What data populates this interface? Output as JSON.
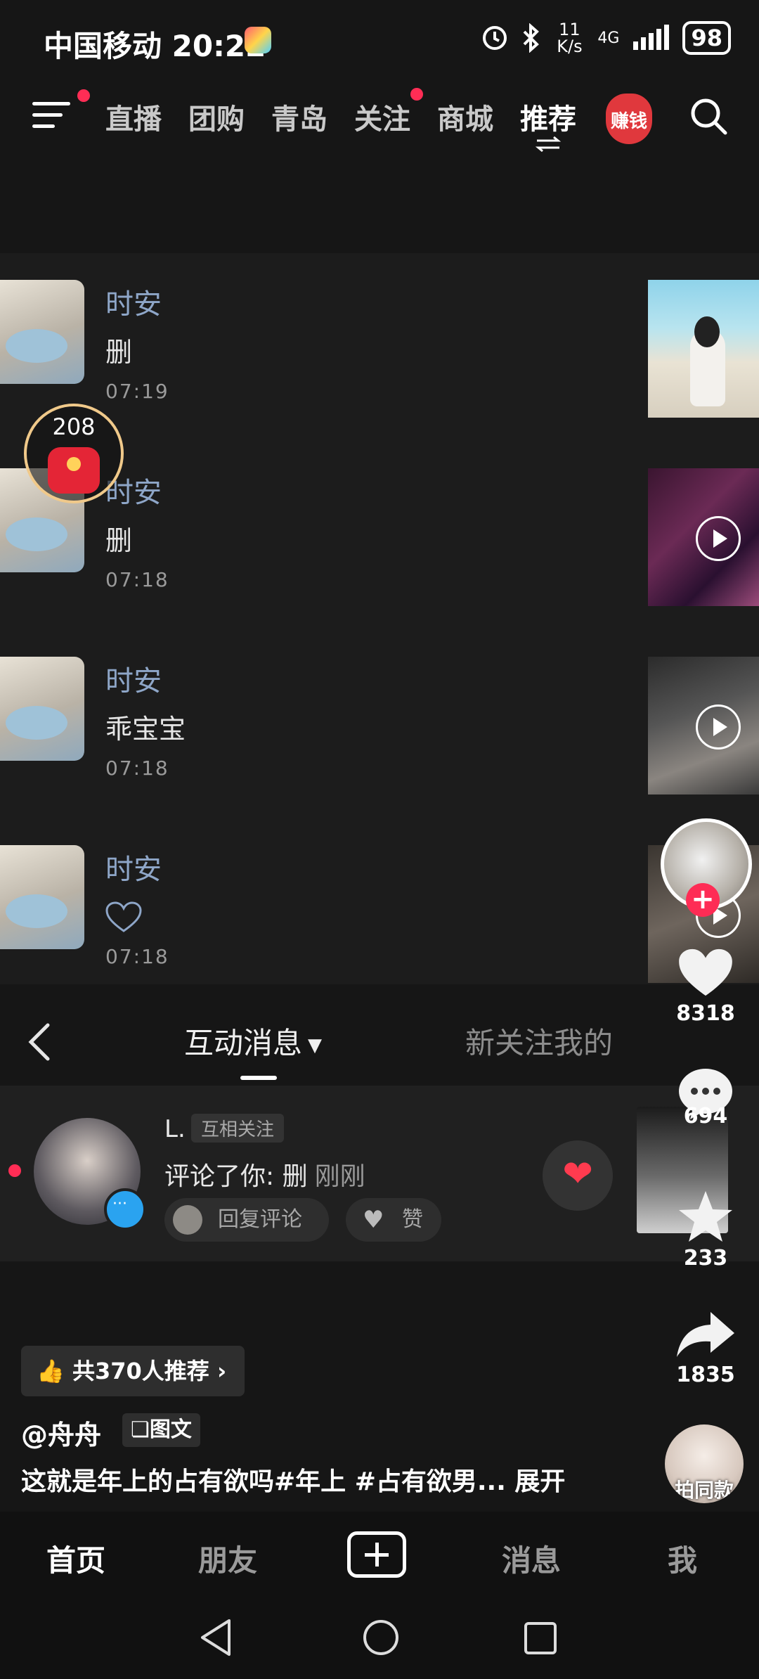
{
  "status_bar": {
    "carrier": "中国移动",
    "time": "20:22",
    "net_speed": "11 K/s",
    "network": "4G",
    "battery": "98"
  },
  "top_nav": {
    "items": [
      {
        "label": "直播"
      },
      {
        "label": "团购"
      },
      {
        "label": "青岛"
      },
      {
        "label": "关注"
      },
      {
        "label": "商城"
      },
      {
        "label": "推荐"
      }
    ],
    "earn_label": "赚钱"
  },
  "envelope_count": "208",
  "messages": [
    {
      "name": "时安",
      "text": "删",
      "time": "07:19"
    },
    {
      "name": "时安",
      "text": "删",
      "time": "07:18"
    },
    {
      "name": "时安",
      "text": "乖宝宝",
      "time": "07:18"
    },
    {
      "name": "时安",
      "text": "",
      "time": "07:18"
    }
  ],
  "notification_header": {
    "tab_interact": "互动消息",
    "tab_new_follow": "新关注我的"
  },
  "notification": {
    "name": "L.",
    "tag": "互相关注",
    "action": "评论了你: 删",
    "when": "刚刚",
    "reply_label": "回复评论",
    "like_label": "赞"
  },
  "rail": {
    "likes": "8318",
    "comments": "694",
    "favorites": "233",
    "shares": "1835"
  },
  "recommend_label": "共370人推荐",
  "author": "@舟舟",
  "post_type": "图文",
  "description": "这就是年上的占有欲吗#年上 #占有欲男... 展开",
  "same_style": "拍同款",
  "tabbar": {
    "home": "首页",
    "friends": "朋友",
    "inbox": "消息",
    "me": "我"
  },
  "colors": {
    "accent": "#fe2c55",
    "name_blue": "#8ea6c8",
    "background": "#161616"
  }
}
